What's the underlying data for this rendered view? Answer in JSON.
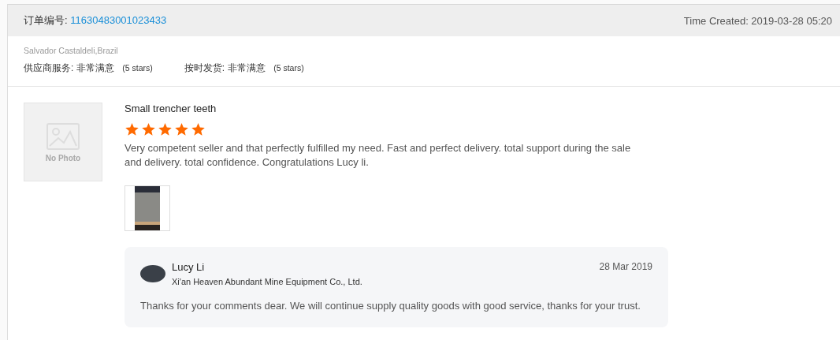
{
  "order": {
    "label": "订单编号:",
    "number": "11630483001023433",
    "time_created": "Time Created: 2019-03-28 05:20"
  },
  "buyer": {
    "name_location": "Salvador Castaldeli,Brazil"
  },
  "ratings": [
    {
      "label": "供应商服务:",
      "value": "非常满意",
      "stars_text": "(5 stars)"
    },
    {
      "label": "按时发货:",
      "value": "非常满意",
      "stars_text": "(5 stars)"
    }
  ],
  "review": {
    "product_placeholder": "No Photo",
    "product_name": "Small trencher teeth",
    "stars": 5,
    "text": "Very competent seller and that perfectly fulfilled my need. Fast and perfect delivery. total support during the sale and delivery. total confidence. Congratulations Lucy li."
  },
  "reply": {
    "author": "Lucy Li",
    "company": "Xi'an Heaven Abundant Mine Equipment Co., Ltd.",
    "date": "28 Mar 2019",
    "text": "Thanks for your comments dear. We will continue supply quality goods with good service, thanks for your trust."
  }
}
